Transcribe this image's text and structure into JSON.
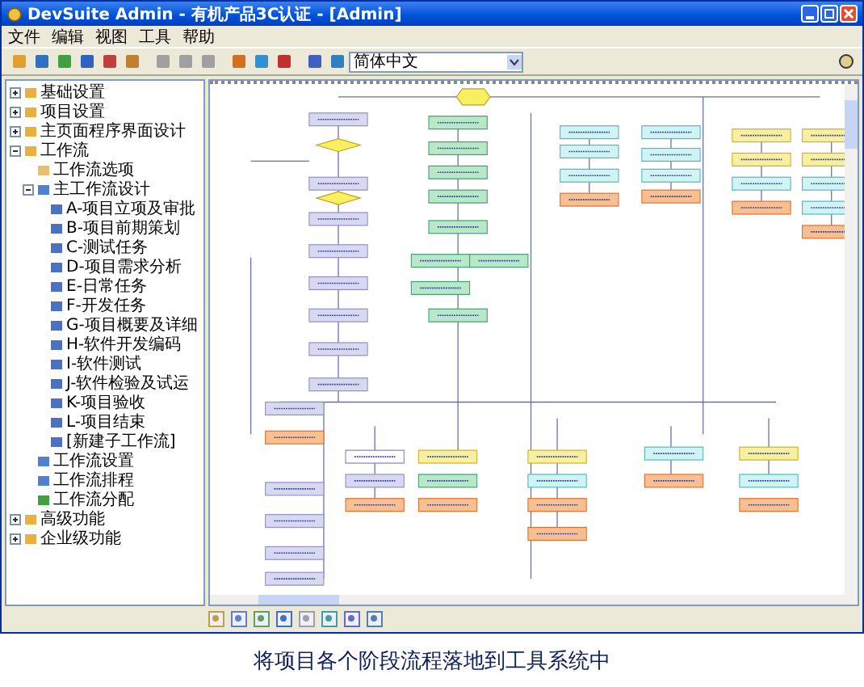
{
  "window": {
    "title": "DevSuite Admin - 有机产品3C认证 - [Admin]"
  },
  "menu": [
    "文件",
    "编辑",
    "视图",
    "工具",
    "帮助"
  ],
  "toolbar": {
    "language": "简体中文"
  },
  "tree": [
    {
      "label": "基础设置",
      "kind": "folder",
      "expanded": false
    },
    {
      "label": "项目设置",
      "kind": "folder",
      "expanded": false
    },
    {
      "label": "主页面程序界面设计",
      "kind": "folder",
      "expanded": false
    },
    {
      "label": "工作流",
      "kind": "folder",
      "expanded": true,
      "children": [
        {
          "label": "工作流选项",
          "kind": "page"
        },
        {
          "label": "主工作流设计",
          "kind": "flow",
          "expanded": true,
          "children": [
            {
              "label": "A-项目立项及审批",
              "kind": "doc"
            },
            {
              "label": "B-项目前期策划",
              "kind": "doc"
            },
            {
              "label": "C-测试任务",
              "kind": "doc"
            },
            {
              "label": "D-项目需求分析",
              "kind": "doc"
            },
            {
              "label": "E-日常任务",
              "kind": "doc"
            },
            {
              "label": "F-开发任务",
              "kind": "doc"
            },
            {
              "label": "G-项目概要及详细",
              "kind": "doc"
            },
            {
              "label": "H-软件开发编码",
              "kind": "doc"
            },
            {
              "label": "I-软件测试",
              "kind": "doc"
            },
            {
              "label": "J-软件检验及试运",
              "kind": "doc"
            },
            {
              "label": "K-项目验收",
              "kind": "doc"
            },
            {
              "label": "L-项目结束",
              "kind": "doc"
            },
            {
              "label": "[新建子工作流]",
              "kind": "doc"
            }
          ]
        },
        {
          "label": "工作流设置",
          "kind": "flow"
        },
        {
          "label": "工作流排程",
          "kind": "flow"
        },
        {
          "label": "工作流分配",
          "kind": "assign"
        }
      ]
    },
    {
      "label": "高级功能",
      "kind": "folder",
      "expanded": false
    },
    {
      "label": "企业级功能",
      "kind": "folder",
      "expanded": false
    }
  ],
  "caption": "将项目各个阶段流程落地到工具系统中"
}
